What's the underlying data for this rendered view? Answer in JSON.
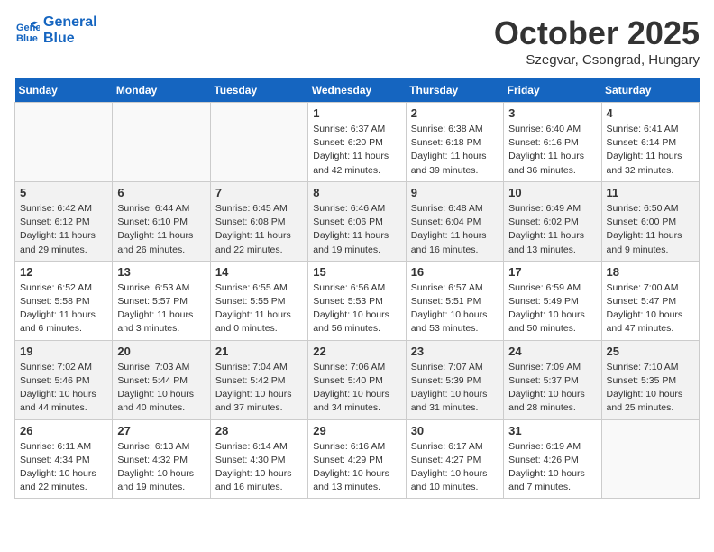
{
  "header": {
    "logo_line1": "General",
    "logo_line2": "Blue",
    "month": "October 2025",
    "location": "Szegvar, Csongrad, Hungary"
  },
  "days_of_week": [
    "Sunday",
    "Monday",
    "Tuesday",
    "Wednesday",
    "Thursday",
    "Friday",
    "Saturday"
  ],
  "weeks": [
    [
      {
        "day": "",
        "info": ""
      },
      {
        "day": "",
        "info": ""
      },
      {
        "day": "",
        "info": ""
      },
      {
        "day": "1",
        "info": "Sunrise: 6:37 AM\nSunset: 6:20 PM\nDaylight: 11 hours\nand 42 minutes."
      },
      {
        "day": "2",
        "info": "Sunrise: 6:38 AM\nSunset: 6:18 PM\nDaylight: 11 hours\nand 39 minutes."
      },
      {
        "day": "3",
        "info": "Sunrise: 6:40 AM\nSunset: 6:16 PM\nDaylight: 11 hours\nand 36 minutes."
      },
      {
        "day": "4",
        "info": "Sunrise: 6:41 AM\nSunset: 6:14 PM\nDaylight: 11 hours\nand 32 minutes."
      }
    ],
    [
      {
        "day": "5",
        "info": "Sunrise: 6:42 AM\nSunset: 6:12 PM\nDaylight: 11 hours\nand 29 minutes."
      },
      {
        "day": "6",
        "info": "Sunrise: 6:44 AM\nSunset: 6:10 PM\nDaylight: 11 hours\nand 26 minutes."
      },
      {
        "day": "7",
        "info": "Sunrise: 6:45 AM\nSunset: 6:08 PM\nDaylight: 11 hours\nand 22 minutes."
      },
      {
        "day": "8",
        "info": "Sunrise: 6:46 AM\nSunset: 6:06 PM\nDaylight: 11 hours\nand 19 minutes."
      },
      {
        "day": "9",
        "info": "Sunrise: 6:48 AM\nSunset: 6:04 PM\nDaylight: 11 hours\nand 16 minutes."
      },
      {
        "day": "10",
        "info": "Sunrise: 6:49 AM\nSunset: 6:02 PM\nDaylight: 11 hours\nand 13 minutes."
      },
      {
        "day": "11",
        "info": "Sunrise: 6:50 AM\nSunset: 6:00 PM\nDaylight: 11 hours\nand 9 minutes."
      }
    ],
    [
      {
        "day": "12",
        "info": "Sunrise: 6:52 AM\nSunset: 5:58 PM\nDaylight: 11 hours\nand 6 minutes."
      },
      {
        "day": "13",
        "info": "Sunrise: 6:53 AM\nSunset: 5:57 PM\nDaylight: 11 hours\nand 3 minutes."
      },
      {
        "day": "14",
        "info": "Sunrise: 6:55 AM\nSunset: 5:55 PM\nDaylight: 11 hours\nand 0 minutes."
      },
      {
        "day": "15",
        "info": "Sunrise: 6:56 AM\nSunset: 5:53 PM\nDaylight: 10 hours\nand 56 minutes."
      },
      {
        "day": "16",
        "info": "Sunrise: 6:57 AM\nSunset: 5:51 PM\nDaylight: 10 hours\nand 53 minutes."
      },
      {
        "day": "17",
        "info": "Sunrise: 6:59 AM\nSunset: 5:49 PM\nDaylight: 10 hours\nand 50 minutes."
      },
      {
        "day": "18",
        "info": "Sunrise: 7:00 AM\nSunset: 5:47 PM\nDaylight: 10 hours\nand 47 minutes."
      }
    ],
    [
      {
        "day": "19",
        "info": "Sunrise: 7:02 AM\nSunset: 5:46 PM\nDaylight: 10 hours\nand 44 minutes."
      },
      {
        "day": "20",
        "info": "Sunrise: 7:03 AM\nSunset: 5:44 PM\nDaylight: 10 hours\nand 40 minutes."
      },
      {
        "day": "21",
        "info": "Sunrise: 7:04 AM\nSunset: 5:42 PM\nDaylight: 10 hours\nand 37 minutes."
      },
      {
        "day": "22",
        "info": "Sunrise: 7:06 AM\nSunset: 5:40 PM\nDaylight: 10 hours\nand 34 minutes."
      },
      {
        "day": "23",
        "info": "Sunrise: 7:07 AM\nSunset: 5:39 PM\nDaylight: 10 hours\nand 31 minutes."
      },
      {
        "day": "24",
        "info": "Sunrise: 7:09 AM\nSunset: 5:37 PM\nDaylight: 10 hours\nand 28 minutes."
      },
      {
        "day": "25",
        "info": "Sunrise: 7:10 AM\nSunset: 5:35 PM\nDaylight: 10 hours\nand 25 minutes."
      }
    ],
    [
      {
        "day": "26",
        "info": "Sunrise: 6:11 AM\nSunset: 4:34 PM\nDaylight: 10 hours\nand 22 minutes."
      },
      {
        "day": "27",
        "info": "Sunrise: 6:13 AM\nSunset: 4:32 PM\nDaylight: 10 hours\nand 19 minutes."
      },
      {
        "day": "28",
        "info": "Sunrise: 6:14 AM\nSunset: 4:30 PM\nDaylight: 10 hours\nand 16 minutes."
      },
      {
        "day": "29",
        "info": "Sunrise: 6:16 AM\nSunset: 4:29 PM\nDaylight: 10 hours\nand 13 minutes."
      },
      {
        "day": "30",
        "info": "Sunrise: 6:17 AM\nSunset: 4:27 PM\nDaylight: 10 hours\nand 10 minutes."
      },
      {
        "day": "31",
        "info": "Sunrise: 6:19 AM\nSunset: 4:26 PM\nDaylight: 10 hours\nand 7 minutes."
      },
      {
        "day": "",
        "info": ""
      }
    ]
  ]
}
